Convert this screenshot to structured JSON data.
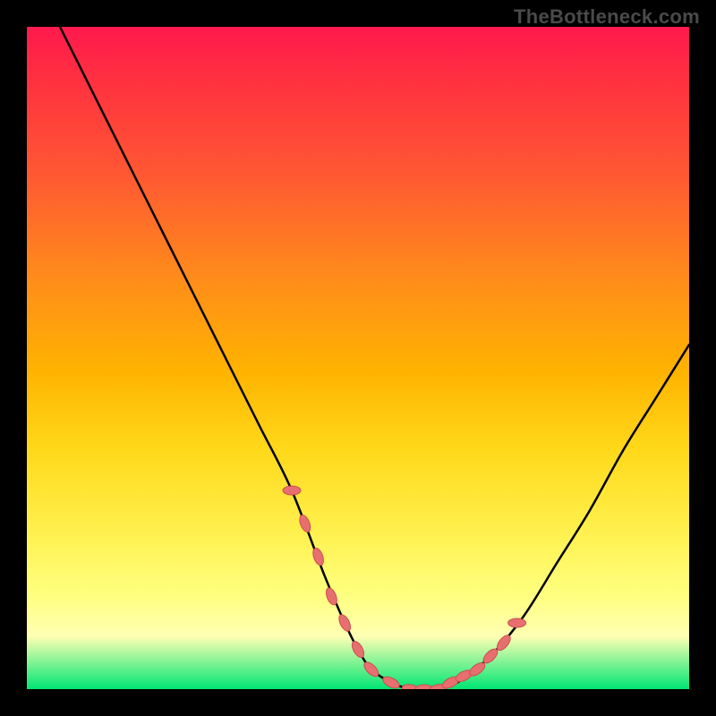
{
  "watermark": "TheBottleneck.com",
  "colors": {
    "background": "#000000",
    "gradient_top": "#ff1a4d",
    "gradient_bottom": "#00e673",
    "curve_stroke": "#000000",
    "marker_fill": "#e76f6f",
    "marker_stroke": "#c94f4f"
  },
  "chart_data": {
    "type": "line",
    "title": "",
    "xlabel": "",
    "ylabel": "",
    "xlim": [
      0,
      100
    ],
    "ylim": [
      0,
      100
    ],
    "grid": false,
    "legend": null,
    "series": [
      {
        "name": "bottleneck-curve",
        "x": [
          5,
          10,
          15,
          20,
          25,
          30,
          35,
          40,
          45,
          48,
          50,
          52,
          55,
          58,
          60,
          62,
          65,
          70,
          75,
          80,
          85,
          90,
          95,
          100
        ],
        "y": [
          100,
          90,
          80,
          70,
          60,
          50,
          40,
          30,
          17,
          10,
          6,
          3,
          1,
          0,
          0,
          0,
          1,
          5,
          11,
          19,
          27,
          36,
          44,
          52
        ]
      }
    ],
    "markers": {
      "name": "highlight-points",
      "x": [
        40,
        42,
        44,
        46,
        48,
        50,
        52,
        55,
        58,
        60,
        62,
        64,
        66,
        68,
        70,
        72,
        74
      ],
      "y": [
        30,
        25,
        20,
        14,
        10,
        6,
        3,
        1,
        0,
        0,
        0,
        1,
        2,
        3,
        5,
        7,
        10
      ]
    },
    "annotations": []
  }
}
